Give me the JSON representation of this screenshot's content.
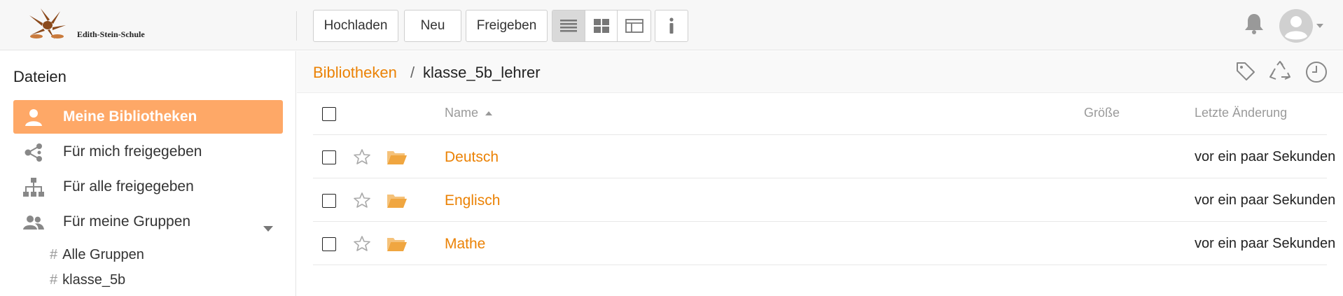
{
  "header": {
    "logo_text": "Edith-Stein-Schule",
    "buttons": {
      "upload": "Hochladen",
      "new": "Neu",
      "share": "Freigeben"
    },
    "view_modes": [
      "list-view-icon",
      "grid-view-icon",
      "column-view-icon"
    ],
    "active_view": "list",
    "accent": "#eb8205"
  },
  "sidebar": {
    "title": "Dateien",
    "items": [
      {
        "label": "Meine Bibliotheken",
        "icon": "user-icon",
        "active": true
      },
      {
        "label": "Für mich freigegeben",
        "icon": "share-icon",
        "active": false
      },
      {
        "label": "Für alle freigegeben",
        "icon": "org-tree-icon",
        "active": false
      },
      {
        "label": "Für meine Gruppen",
        "icon": "group-icon",
        "active": false
      }
    ],
    "groups": [
      {
        "label": "Alle Gruppen"
      },
      {
        "label": "klasse_5b"
      }
    ],
    "active_color": "#fea867"
  },
  "main": {
    "breadcrumb": {
      "root": "Bibliotheken",
      "separator": "/",
      "current": "klasse_5b_lehrer"
    },
    "columns": {
      "name": "Name",
      "size": "Größe",
      "modified": "Letzte Änderung"
    },
    "rows": [
      {
        "name": "Deutsch",
        "size": "",
        "modified": "vor ein paar Sekunden"
      },
      {
        "name": "Englisch",
        "size": "",
        "modified": "vor ein paar Sekunden"
      },
      {
        "name": "Mathe",
        "size": "",
        "modified": "vor ein paar Sekunden"
      }
    ]
  }
}
